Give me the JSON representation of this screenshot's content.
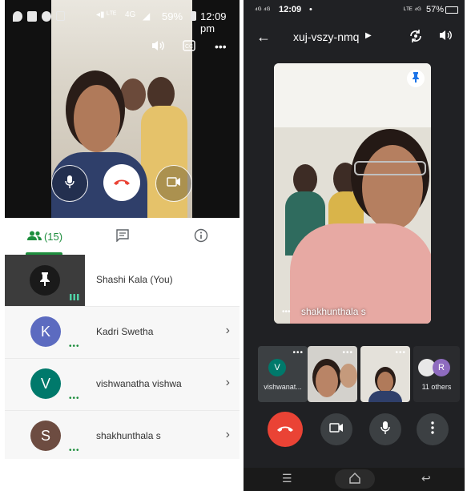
{
  "left": {
    "status": {
      "battery": "59%",
      "time": "12:09 pm",
      "net": "4G"
    },
    "tabs": [
      {
        "label": "(15)"
      },
      {
        "label": ""
      },
      {
        "label": ""
      }
    ],
    "participants": [
      {
        "name": "Shashi Kala (You)",
        "initial": "",
        "color": "#3c3c3c"
      },
      {
        "name": "Kadri Swetha",
        "initial": "K",
        "color": "#5c6bc0"
      },
      {
        "name": "vishwanatha vishwa",
        "initial": "V",
        "color": "#00796b"
      },
      {
        "name": "shakhunthala s",
        "initial": "S",
        "color": "#6d4c41"
      }
    ]
  },
  "right": {
    "status": {
      "time": "12:09",
      "battery": "57%"
    },
    "meeting_code": "xuj-vszy-nmq",
    "main_name": "shakhunthala s",
    "tiles": [
      {
        "label": "vishwanat...",
        "initial": "V"
      },
      {
        "label": ""
      },
      {
        "label": ""
      },
      {
        "label": "11 others",
        "initial": "R"
      }
    ]
  },
  "colors": {
    "accent_green": "#1e8e3e",
    "end_red": "#ea4335"
  }
}
